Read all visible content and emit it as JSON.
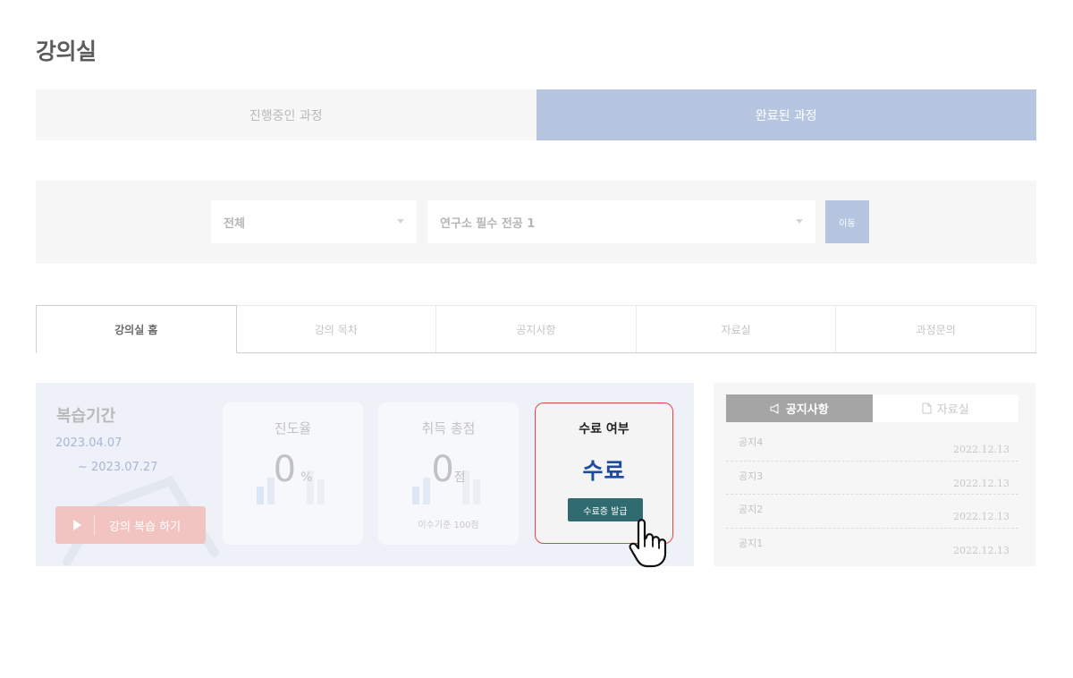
{
  "page": {
    "title": "강의실"
  },
  "main_tabs": [
    {
      "label": "진행중인 과정",
      "active": false
    },
    {
      "label": "완료된 과정",
      "active": true
    }
  ],
  "filter": {
    "select_category": "전체",
    "select_course": "연구소 필수 전공 1",
    "move_label": "이동"
  },
  "sub_tabs": [
    {
      "label": "강의실 홈",
      "active": true
    },
    {
      "label": "강의 목차",
      "active": false
    },
    {
      "label": "공지사항",
      "active": false
    },
    {
      "label": "자료실",
      "active": false
    },
    {
      "label": "과정문의",
      "active": false
    }
  ],
  "study": {
    "review_label": "복습기간",
    "review_start": "2023.04.07",
    "review_end": "~ 2023.07.27",
    "review_button": "강의 복습 하기",
    "progress": {
      "label": "진도율",
      "value": "0",
      "unit": "%"
    },
    "score": {
      "label": "취득 총점",
      "value": "0",
      "unit": "점",
      "note": "이수기준 100점"
    },
    "completion": {
      "label": "수료 여부",
      "status": "수료",
      "cert_button": "수료증 발급"
    }
  },
  "notice_panel": {
    "tabs": [
      {
        "label": "공지사항",
        "icon": "megaphone-icon",
        "active": true
      },
      {
        "label": "자료실",
        "icon": "document-icon",
        "active": false
      }
    ],
    "items": [
      {
        "title": "공지4",
        "date": "2022.12.13"
      },
      {
        "title": "공지3",
        "date": "2022.12.13"
      },
      {
        "title": "공지2",
        "date": "2022.12.13"
      },
      {
        "title": "공지1",
        "date": "2022.12.13"
      }
    ]
  },
  "colors": {
    "accent_blue": "#b6c6e1",
    "status_blue": "#1f4aa1",
    "highlight_red": "#e14646",
    "cert_button": "#2f6b70",
    "review_button": "#f1c4c1"
  }
}
